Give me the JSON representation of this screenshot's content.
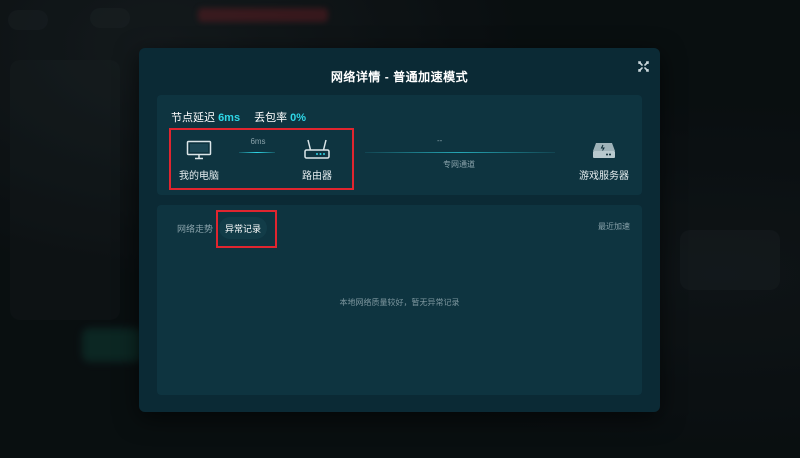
{
  "modal": {
    "title": "网络详情 - 普通加速模式"
  },
  "stats": {
    "delay_label": "节点延迟",
    "delay_value": "6ms",
    "loss_label": "丢包率",
    "loss_value": "0%"
  },
  "route": {
    "pc_label": "我的电脑",
    "router_label": "路由器",
    "server_label": "游戏服务器",
    "pc_router_latency": "6ms",
    "router_server_latency": "--",
    "channel_label": "专网通道"
  },
  "tabs": [
    {
      "label": "网络走势"
    },
    {
      "label": "异常记录"
    }
  ],
  "recent_link": "最近加速",
  "empty_message": "本地网络质量较好，暂无异常记录",
  "colors": {
    "accent": "#2fd6e6",
    "highlight": "#e0252f",
    "modal_bg": "#0b2a35",
    "panel_bg": "#0e3440"
  }
}
